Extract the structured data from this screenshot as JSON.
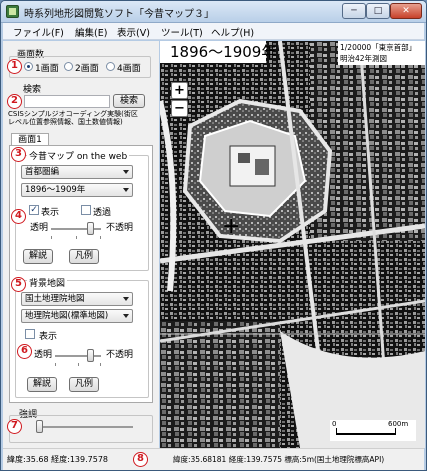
{
  "window": {
    "title": "時系列地形図閲覧ソフト「今昔マップ３」",
    "minimize": "─",
    "maximize": "□",
    "close": "✕"
  },
  "menu": [
    "ファイル(F)",
    "編集(E)",
    "表示(V)",
    "ツール(T)",
    "ヘルプ(H)"
  ],
  "screens": {
    "group_label": "画面数",
    "options": [
      "1画面",
      "2画面",
      "4画面"
    ],
    "selected": "1画面"
  },
  "search": {
    "label": "検索",
    "value": "",
    "button": "検索",
    "note_line1": "CSISシンプルジオコーディング実験(街区",
    "note_line2": "レベル位置参照情報、国土数値情報)"
  },
  "tab": {
    "label": "画面1"
  },
  "web_map": {
    "group_label": "今昔マップ on the web",
    "region": "首都圏編",
    "period": "1896〜1909年",
    "show_label": "表示",
    "show_checked": true,
    "transparent_label": "透過",
    "transparent_checked": false,
    "transparent_text": "透明",
    "opaque_text": "不透明",
    "opacity": 0.8,
    "legend_button": "解説",
    "example_button": "凡例"
  },
  "background_map": {
    "group_label": "背景地図",
    "source": "国土地理院地図",
    "layer": "地理院地図(標準地図)",
    "show_label": "表示",
    "show_checked": false,
    "transparent_text": "透明",
    "opaque_text": "不透明",
    "opacity": 0.8,
    "legend_button": "解説",
    "example_button": "凡例"
  },
  "emphasis": {
    "label": "強調",
    "level": 0.0
  },
  "markers": [
    "1",
    "2",
    "3",
    "4",
    "5",
    "6",
    "7",
    "8"
  ],
  "map": {
    "period_title": "1896〜1909年",
    "info_line1": "1/20000「東京首部」",
    "info_line2": "明治42年測図",
    "zoom_in": "+",
    "zoom_out": "−",
    "scale_start": "0",
    "scale_end": "600m",
    "crosshair": "+"
  },
  "status": {
    "left": "緯度:35.68 経度:139.7578",
    "right": "緯度:35.68181 経度:139.7575 標高:5m(国土地理院標高API)"
  },
  "colors": {
    "marker": "#d0191f",
    "title_bar": "#b9cfe8",
    "map_base": "#1a1a1a"
  }
}
